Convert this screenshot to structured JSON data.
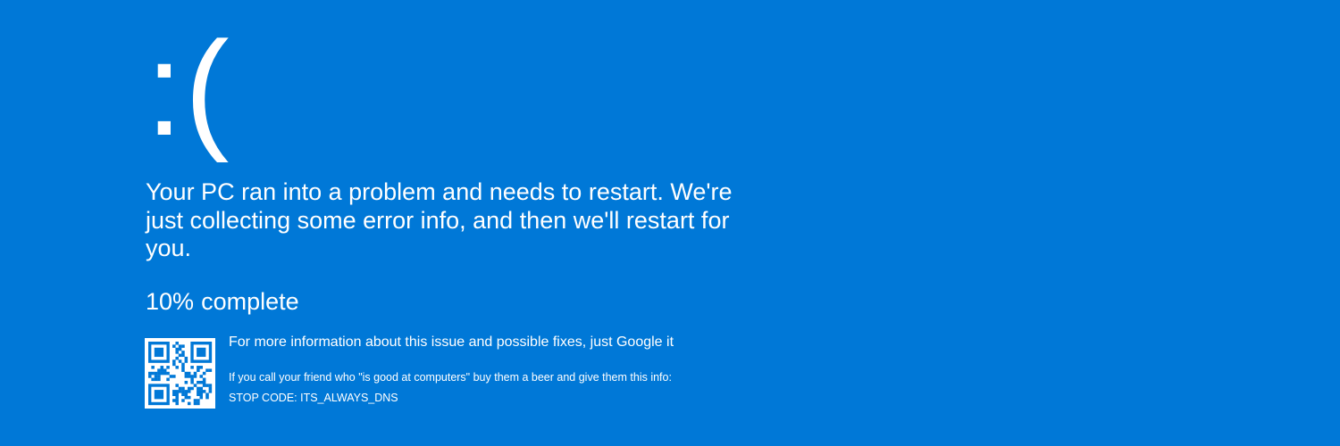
{
  "screen": {
    "background_color": "#0078d7",
    "text_color": "#ffffff",
    "frown_face": ":(",
    "message": "Your PC ran into a problem and needs to restart. We're just collecting some error info, and then we'll restart for you.",
    "progress": {
      "percent": 10,
      "percent_text": "10%",
      "label": "complete"
    },
    "qr_code": {
      "icon": "qr-code-icon"
    },
    "info_text": "For more information about this issue and possible fixes, just Google it",
    "friend_text": "If you call your friend who \"is good at computers\" buy them a beer and give them this info:",
    "stop_code": "STOP CODE: ITS_ALWAYS_DNS"
  }
}
